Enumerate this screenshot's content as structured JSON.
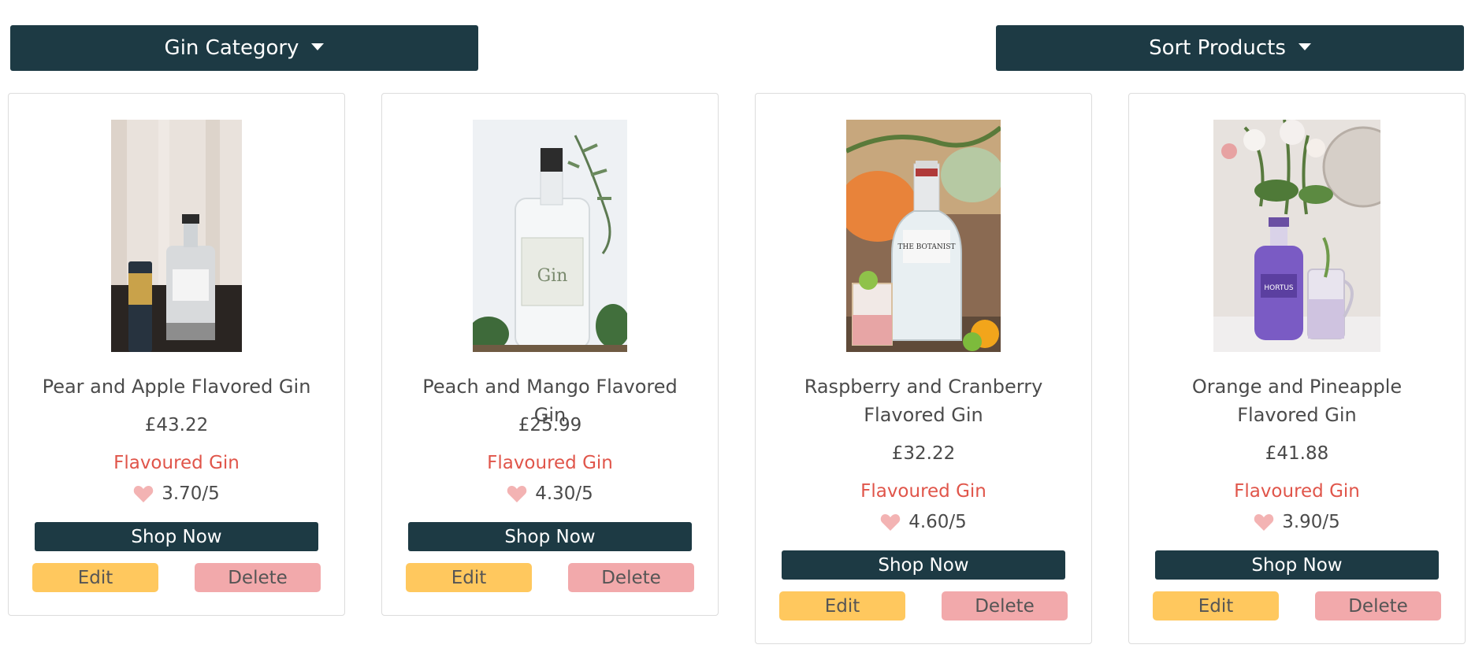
{
  "controls": {
    "category_label": "Gin Category",
    "sort_label": "Sort Products"
  },
  "products": [
    {
      "title": "Pear and Apple Flavored Gin",
      "price": "£43.22",
      "category": "Flavoured Gin",
      "rating": "3.70/5",
      "shop_label": "Shop Now",
      "edit_label": "Edit",
      "delete_label": "Delete"
    },
    {
      "title": "Peach and Mango Flavored Gin",
      "price": "£25.99",
      "category": "Flavoured Gin",
      "rating": "4.30/5",
      "shop_label": "Shop Now",
      "edit_label": "Edit",
      "delete_label": "Delete"
    },
    {
      "title": "Raspberry and Cranberry Flavored Gin",
      "price": "£32.22",
      "category": "Flavoured Gin",
      "rating": "4.60/5",
      "shop_label": "Shop Now",
      "edit_label": "Edit",
      "delete_label": "Delete"
    },
    {
      "title": "Orange and Pineapple Flavored Gin",
      "price": "£41.88",
      "category": "Flavoured Gin",
      "rating": "3.90/5",
      "shop_label": "Shop Now",
      "edit_label": "Edit",
      "delete_label": "Delete"
    }
  ],
  "icons": {
    "rating": "heart-icon",
    "dropdown": "caret-down-icon"
  },
  "colors": {
    "primary": "#1d3a44",
    "category_text": "#e0554a",
    "edit": "#ffc85e",
    "delete": "#f2a9ab",
    "heart": "#f3b3b3"
  }
}
